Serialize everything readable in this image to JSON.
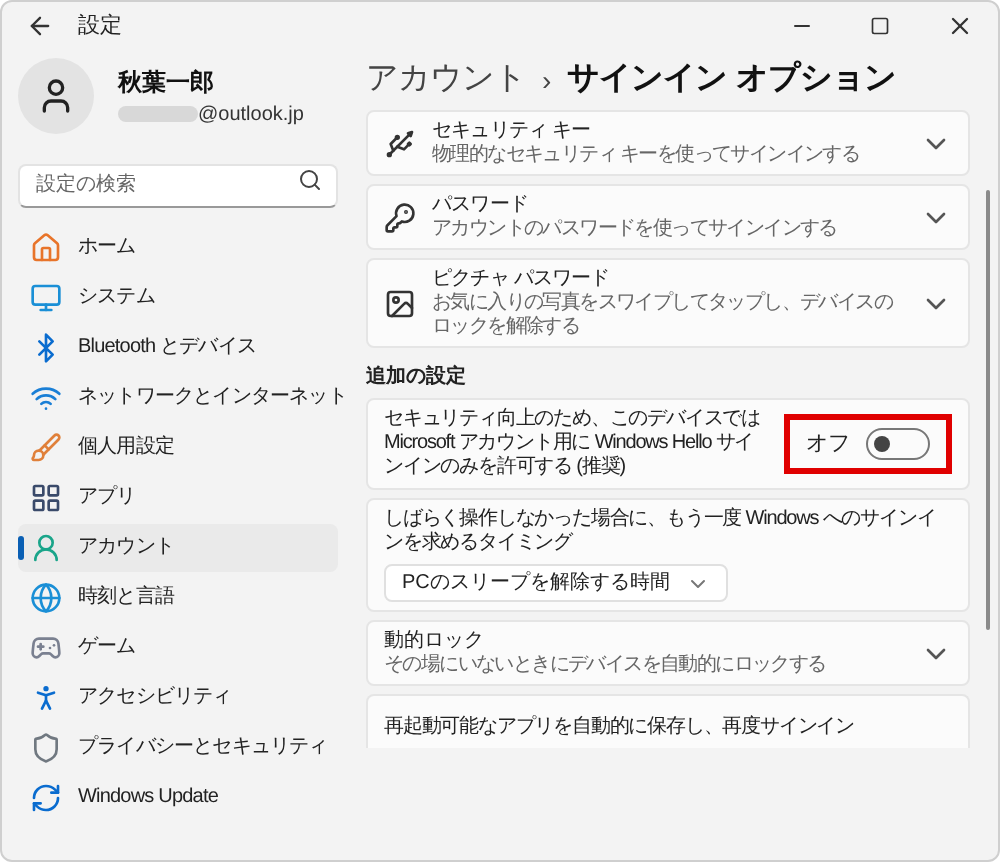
{
  "window": {
    "title": "設定"
  },
  "account": {
    "name": "秋葉一郎",
    "email": "@outlook.jp"
  },
  "search": {
    "placeholder": "設定の検索"
  },
  "sidebar": {
    "items": [
      {
        "label": "ホーム",
        "selected": false
      },
      {
        "label": "システム",
        "selected": false
      },
      {
        "label": "Bluetooth とデバイス",
        "selected": false
      },
      {
        "label": "ネットワークとインターネット",
        "selected": false
      },
      {
        "label": "個人用設定",
        "selected": false
      },
      {
        "label": "アプリ",
        "selected": false
      },
      {
        "label": "アカウント",
        "selected": true
      },
      {
        "label": "時刻と言語",
        "selected": false
      },
      {
        "label": "ゲーム",
        "selected": false
      },
      {
        "label": "アクセシビリティ",
        "selected": false
      },
      {
        "label": "プライバシーとセキュリティ",
        "selected": false
      },
      {
        "label": "Windows Update",
        "selected": false
      }
    ]
  },
  "breadcrumb": {
    "parent": "アカウント",
    "separator": "›",
    "current": "サインイン オプション"
  },
  "sign_in_options": [
    {
      "title": "セキュリティ キー",
      "description": "物理的なセキュリティ キーを使ってサインインする"
    },
    {
      "title": "パスワード",
      "description": "アカウントのパスワードを使ってサインインする"
    },
    {
      "title": "ピクチャ パスワード",
      "description": "お気に入りの写真をスワイプしてタップし、デバイスのロックを解除する"
    }
  ],
  "additional": {
    "heading": "追加の設定",
    "settings": [
      {
        "kind": "toggle",
        "text": "セキュリティ向上のため、このデバイスでは Microsoft アカウント用に Windows Hello サインインのみを許可する (推奨)",
        "state_label": "オフ",
        "on": false,
        "highlighted": true
      },
      {
        "kind": "dropdown",
        "text": "しばらく操作しなかった場合に、もう一度 Windows へのサインインを求めるタイミング",
        "value": "PCのスリープを解除する時間"
      },
      {
        "kind": "expander",
        "title": "動的ロック",
        "description": "その場にいないときにデバイスを自動的にロックする"
      },
      {
        "kind": "partial",
        "text": "再起動可能なアプリを自動的に保存し、再度サインイン"
      }
    ]
  }
}
